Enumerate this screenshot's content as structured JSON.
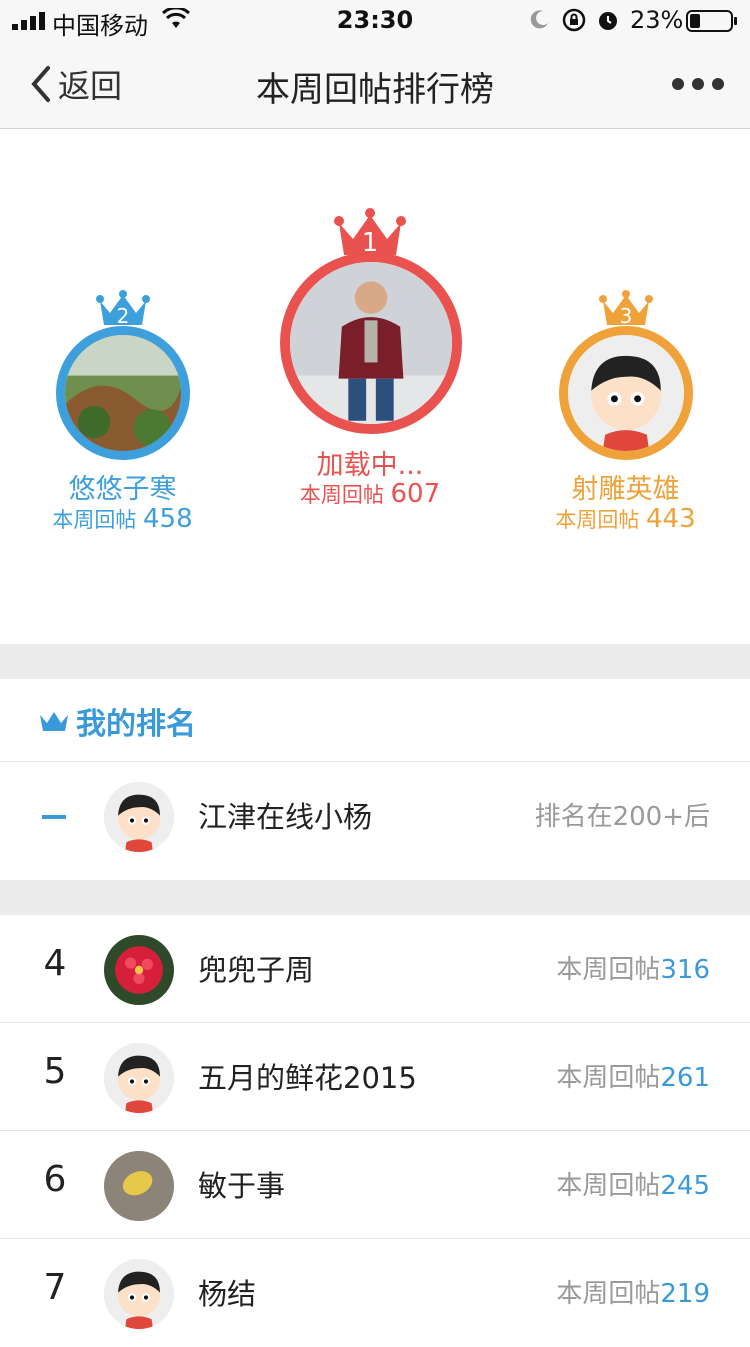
{
  "status_bar": {
    "carrier": "中国移动",
    "time": "23:30",
    "battery": "23%"
  },
  "nav": {
    "back_label": "返回",
    "title": "本周回帖排行榜"
  },
  "podium": {
    "first": {
      "rank": "1",
      "name": "加载中...",
      "count_label": "本周回帖",
      "count": "607",
      "color": "#e9524f"
    },
    "second": {
      "rank": "2",
      "name": "悠悠子寒",
      "count_label": "本周回帖",
      "count": "458",
      "color": "#3d9fdc"
    },
    "third": {
      "rank": "3",
      "name": "射雕英雄",
      "count_label": "本周回帖",
      "count": "443",
      "color": "#f0a23a"
    }
  },
  "my_rank": {
    "title": "我的排名",
    "name": "江津在线小杨",
    "status": "排名在200+后"
  },
  "list": [
    {
      "rank": "4",
      "name": "兜兜子周",
      "count_label": "本周回帖",
      "count": "316"
    },
    {
      "rank": "5",
      "name": "五月的鲜花2015",
      "count_label": "本周回帖",
      "count": "261"
    },
    {
      "rank": "6",
      "name": "敏于事",
      "count_label": "本周回帖",
      "count": "245"
    },
    {
      "rank": "7",
      "name": "杨结",
      "count_label": "本周回帖",
      "count": "219"
    }
  ],
  "colors": {
    "accent": "#3a9ad9",
    "gold": "#e9524f",
    "silver": "#3d9fdc",
    "bronze": "#f0a23a"
  }
}
